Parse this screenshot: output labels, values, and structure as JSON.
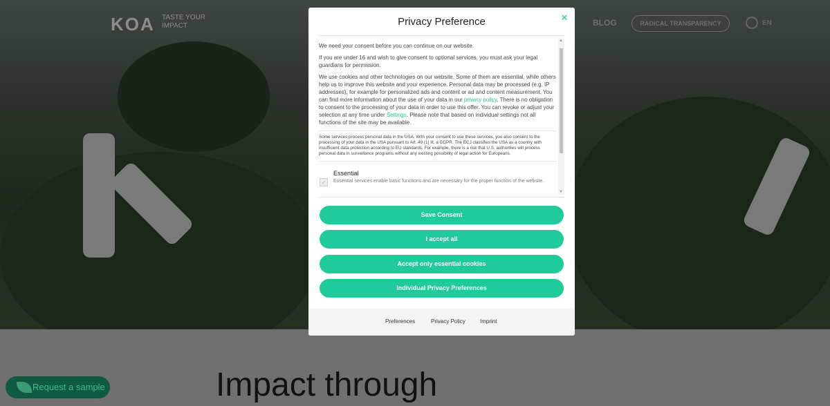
{
  "background": {
    "brand": "KOA",
    "tagline": "TASTE YOUR IMPACT",
    "nav": {
      "blog": "BLOG",
      "transparency": "RADICAL TRANSPARENCY",
      "lang": "EN"
    },
    "sample_button": "Request a sample",
    "headline": "Impact through"
  },
  "modal": {
    "title": "Privacy Preference",
    "close_icon": "close-icon",
    "paragraphs": {
      "p1": "We need your consent before you can continue on our website.",
      "p2": "If you are under 16 and wish to give consent to optional services, you must ask your legal guardians for permission.",
      "p3_a": "We use cookies and other technologies on our website. Some of them are essential, while others help us to improve this website and your experience. Personal data may be processed (e.g. IP addresses), for example for personalized ads and content or ad and content measurement. You can find more information about the use of your data in our ",
      "p3_link": "privacy policy",
      "p3_b": ". There is no obligation to consent to the processing of your data in order to use this offer. You can revoke or adjust your selection at any time under ",
      "p3_settings": "Settings",
      "p3_c": ". Please note that based on individual settings not all functions of the site may be available."
    },
    "usa_note": "Some services process personal data in the USA. With your consent to use these services, you also consent to the processing of your data in the USA pursuant to Art. 49 (1) lit. a GDPR. The ECJ classifies the USA as a country with insufficient data protection according to EU standards. For example, there is a risk that U.S. authorities will process personal data in surveillance programs without any existing possibility of legal action for Europeans.",
    "essential": {
      "title": "Essential",
      "description": "Essential services enable basic functions and are necessary for the proper function of the website.",
      "checked": true
    },
    "buttons": {
      "save": "Save Consent",
      "accept_all": "I accept all",
      "essential_only": "Accept only essential cookies",
      "individual": "Individual Privacy Preferences"
    },
    "footer": {
      "preferences": "Preferences",
      "privacy_policy": "Privacy Policy",
      "imprint": "Imprint"
    },
    "accent_color": "#1fcb9a"
  }
}
